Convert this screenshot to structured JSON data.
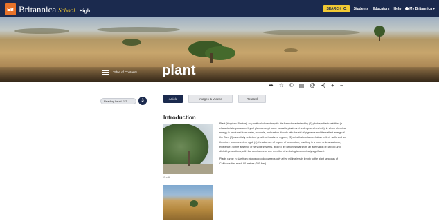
{
  "header": {
    "brand_name": "Britannica",
    "brand_school": "School",
    "brand_level": "High",
    "search_label": "SEARCH",
    "nav_links": [
      "Students",
      "Educators",
      "Help"
    ],
    "account_label": "My Britannica"
  },
  "hero": {
    "title": "plant",
    "toc_label": "Table of Contents"
  },
  "reading_level": {
    "label": "Reading Level",
    "values": "1 2",
    "current": "3"
  },
  "tabs": [
    {
      "label": "Article",
      "active": true
    },
    {
      "label": "Images & Videos",
      "active": false
    },
    {
      "label": "Related",
      "active": false
    }
  ],
  "tools": [
    "share-icon",
    "star-icon",
    "cite-icon",
    "print-icon",
    "email-icon",
    "audio-icon",
    "zoom-in-icon",
    "zoom-out-icon"
  ],
  "article": {
    "section_title": "Introduction",
    "image1_caption": "Credit",
    "paragraph1": "Plant (kingdom Plantae), any multicellular eukaryotic life-form characterized by (1) photosynthetic nutrition (a characteristic possessed by all plants except some parasitic plants and underground orchids), in which chemical energy is produced from water, minerals, and carbon dioxide with the aid of pigments and the radiant energy of the Sun, (2) essentially unlimited growth at localized regions, (3) cells that contain cellulose in their walls and are therefore to some extent rigid, (4) the absence of organs of locomotion, resulting in a more or less stationary existence, (5) the absence of nervous systems, and (6) life histories that show an alternation of haploid and diploid generations, with the dominance of one over the other being taxonomically significant.",
    "paragraph2": "Plants range in size from microscopic duckweeds only a few millimetres in length to the giant sequoias of California that reach 90 metres (300 feet)"
  },
  "colors": {
    "navy": "#1b2a4e",
    "gold": "#f1c933",
    "logo_orange": "#e8732a"
  }
}
